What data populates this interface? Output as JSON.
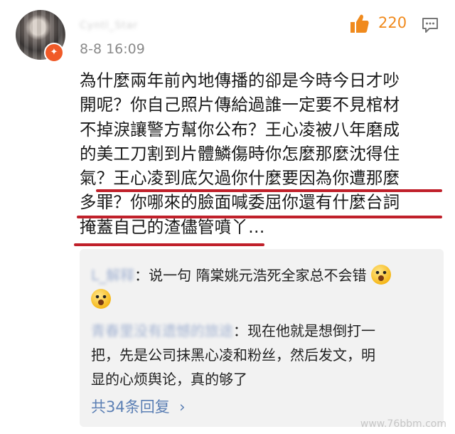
{
  "comment": {
    "username": "Cyntl_Star",
    "timestamp": "8-8 16:09",
    "like_count": "220",
    "icons": [
      "avatar",
      "vip-badge-icon",
      "like-icon",
      "reply-icon",
      "chevron-right-icon"
    ],
    "accent_color": "#f08a1d",
    "underline_color": "#c0202a",
    "body_lines": [
      "為什麼兩年前內地傳播的卻是今時今日才吵",
      "開呢？你自己照片傳給過誰一定要不見棺材",
      "不掉淚讓警方幫你公布？王心凌被八年磨成",
      "的美工刀割到片體鱗傷時你怎麼那麼沈得住",
      "氣？王心凌到底欠過你什麼要因為你遭那麼",
      "多罪？你哪來的臉面喊委屈你還有什麼台詞",
      "掩蓋自己的渣儘管噴丫…"
    ]
  },
  "replies": {
    "items": [
      {
        "user": "L_解释",
        "text_line1": "：说一句 隋棠姚元浩死全家总不会错"
      },
      {
        "user": "青春里没有遗憾的旅途",
        "text_line1": "：现在他就是想倒打一",
        "text_line2": "把，先是公司抹黑心凌和粉丝，然后发文，明",
        "text_line3": "显的心烦舆论，真的够了"
      }
    ],
    "more_label": "共34条回复",
    "more_color": "#5b7fb4"
  },
  "watermark": "www.76bbm.com"
}
